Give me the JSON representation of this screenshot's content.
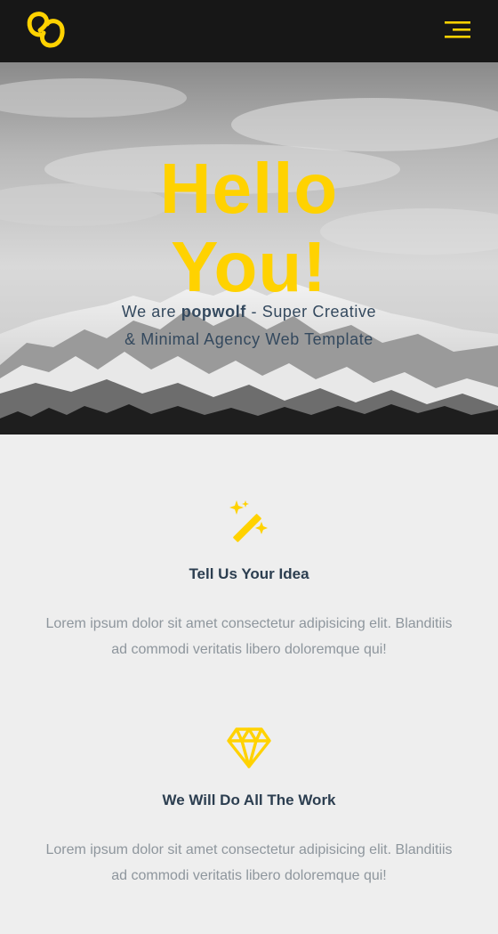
{
  "navbar": {
    "logo_icon": "popwolf-logo-icon",
    "menu_icon": "hamburger-menu-icon",
    "accent_color": "#ffd200",
    "background_color": "#171717"
  },
  "hero": {
    "title_line1": "Hello",
    "title_line2": "You!",
    "subtitle_prefix": "We are",
    "subtitle_brand": "popwolf",
    "subtitle_suffix": "- Super Creative",
    "subtitle_line2": "& Minimal Agency Web Template",
    "background": "snowy-mountains-image"
  },
  "features": [
    {
      "icon": "magic-wand-icon",
      "title": "Tell Us Your Idea",
      "text_line1": "Lorem ipsum dolor sit amet consectetur adipisicing elit. Blanditiis",
      "text_line2": "ad commodi veritatis libero doloremque qui!"
    },
    {
      "icon": "diamond-icon",
      "title": "We Will Do All The Work",
      "text_line1": "Lorem ipsum dolor sit amet consectetur adipisicing elit. Blanditiis",
      "text_line2": "ad commodi veritatis libero doloremque qui!"
    }
  ]
}
